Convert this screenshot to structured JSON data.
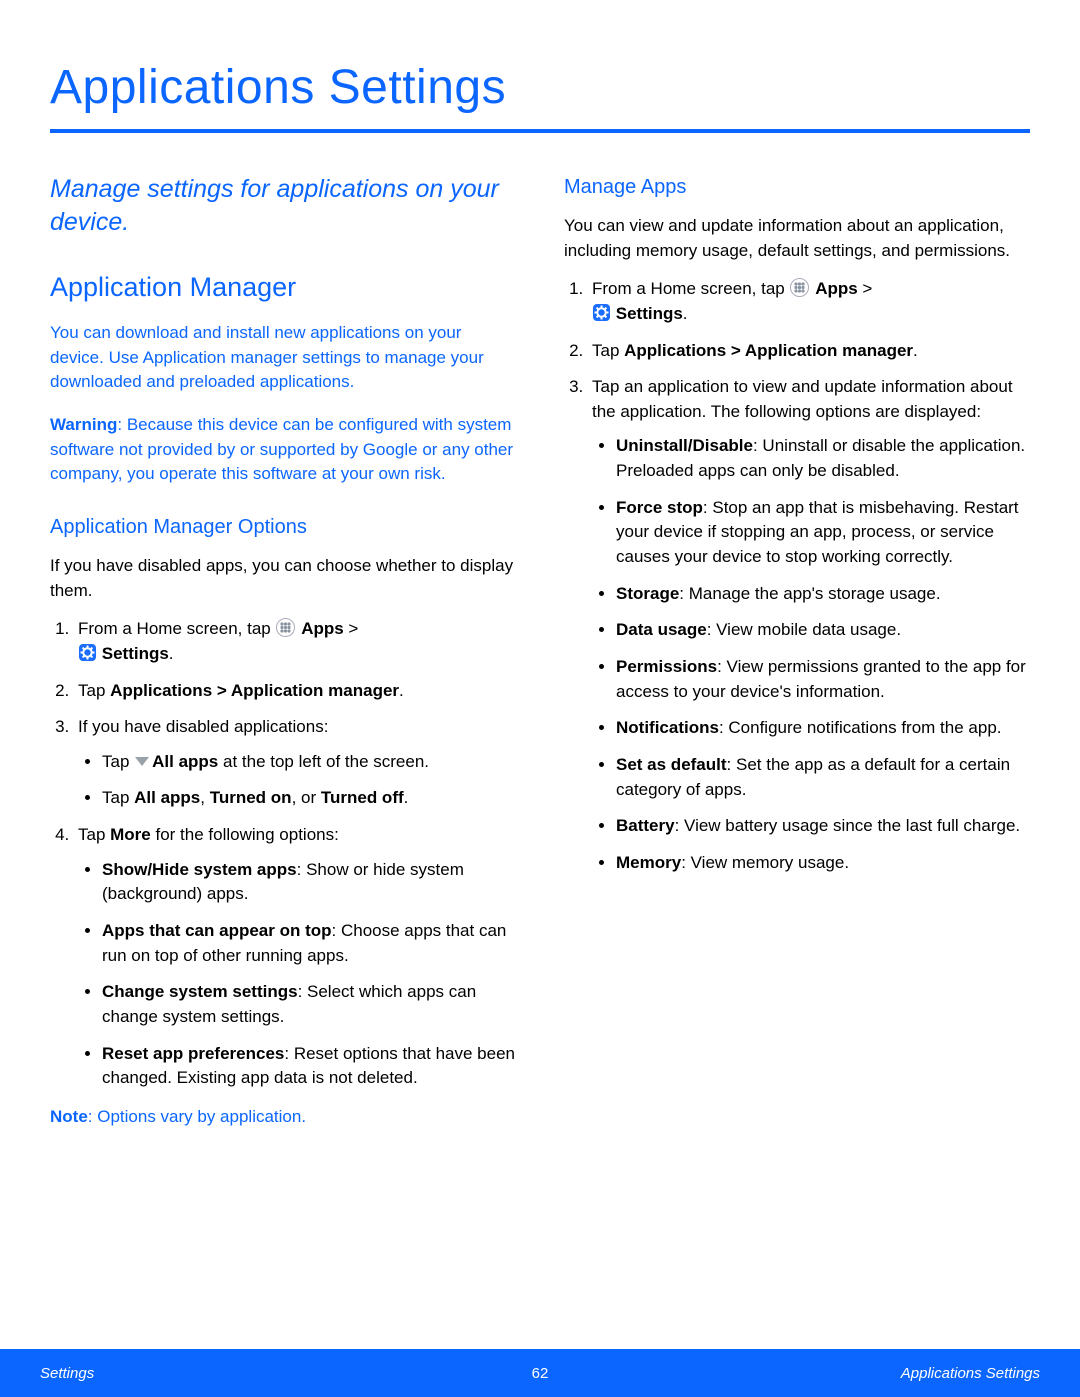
{
  "page": {
    "title": "Applications Settings",
    "intro": "Manage settings for applications on your device."
  },
  "left": {
    "h2": "Application Manager",
    "p1": "You can download and install new applications on your device. Use Application manager settings to manage your downloaded and preloaded applications.",
    "warn_label": "Warning",
    "warn_text": ": Because this device can be configured with system software not provided by or supported by Google or any other company, you operate this software at your own risk.",
    "h3": "Application Manager Options",
    "p3": "If you have disabled apps, you can choose whether to display them.",
    "step1_pre": "From a Home screen, tap ",
    "apps_label": "Apps",
    "gt": " > ",
    "settings_label": "Settings",
    "period": ".",
    "step2_pre": "Tap ",
    "step2_bold": "Applications > Application manager",
    "step3": "If you have disabled applications:",
    "step3a_pre": "Tap ",
    "step3a_bold": "All apps",
    "step3a_post": " at the top left of the screen.",
    "step3b_pre": "Tap ",
    "step3b_b1": "All apps",
    "step3b_c1": ", ",
    "step3b_b2": "Turned on",
    "step3b_c2": ", or ",
    "step3b_b3": "Turned off",
    "step4_pre": "Tap ",
    "step4_bold": "More",
    "step4_post": " for the following options:",
    "step4a_b": "Show/Hide system apps",
    "step4a_t": ": Show or hide system (background) apps.",
    "step4b_b": "Apps that can appear on top",
    "step4b_t": ": Choose apps that can run on top of other running apps.",
    "step4c_b": "Change system settings",
    "step4c_t": ": Select which apps can change system settings.",
    "step4d_b": "Reset app preferences",
    "step4d_t": ": Reset options that have been changed. Existing app data is not deleted.",
    "note_label": "Note",
    "note_text": ": Options vary by application."
  },
  "right": {
    "h3": "Manage Apps",
    "p1": "You can view and update information about an application, including memory usage, default settings, and permissions.",
    "step3_text": "Tap an application to view and update information about the application. The following options are displayed:",
    "opt1_b": "Uninstall/Disable",
    "opt1_t": ": Uninstall or disable the application. Preloaded apps can only be disabled.",
    "opt2_b": "Force stop",
    "opt2_t": ": Stop an app that is misbehaving. Restart your device if stopping an app, process, or service causes your device to stop working correctly.",
    "opt3_b": "Storage",
    "opt3_t": ": Manage the app's storage usage.",
    "opt4_b": "Data usage",
    "opt4_t": ": View mobile data usage.",
    "opt5_b": "Permissions",
    "opt5_t": ": View permissions granted to the app for access to your device's information.",
    "opt6_b": "Notifications",
    "opt6_t": ": Configure notifications from the app.",
    "opt7_b": "Set as default",
    "opt7_t": ": Set the app as a default for a certain category of apps.",
    "opt8_b": "Battery",
    "opt8_t": ": View battery usage since the last full charge.",
    "opt9_b": "Memory",
    "opt9_t": ": View memory usage."
  },
  "footer": {
    "left": "Settings",
    "center": "62",
    "right": "Applications Settings"
  }
}
